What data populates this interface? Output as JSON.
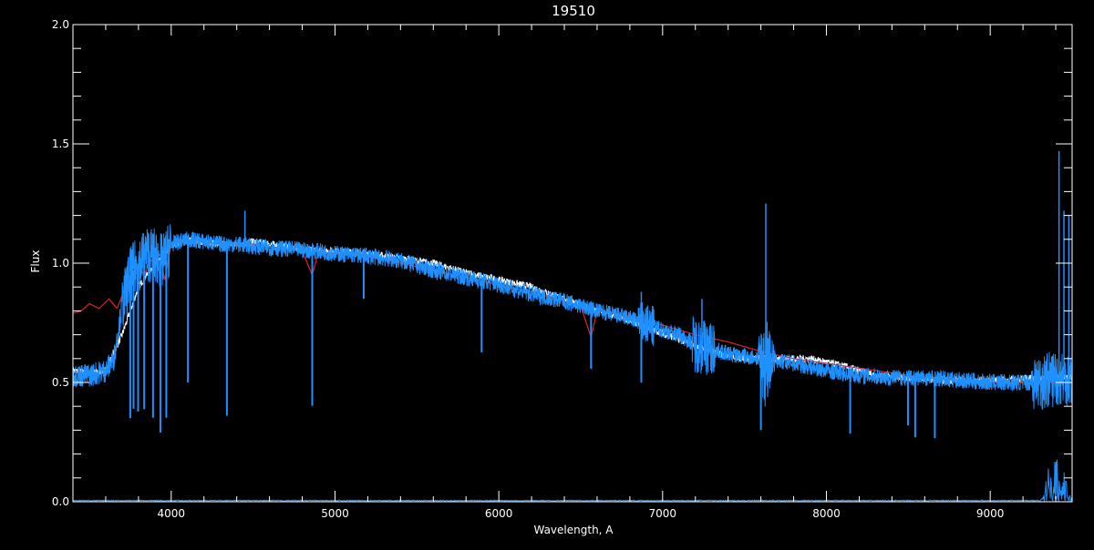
{
  "chart_data": {
    "type": "line",
    "title": "19510",
    "xlabel": "Wavelength, A",
    "ylabel": "Flux",
    "xlim": [
      3400,
      9500
    ],
    "ylim": [
      0.0,
      2.0
    ],
    "x_ticks": [
      4000,
      5000,
      6000,
      7000,
      8000,
      9000
    ],
    "x_tick_labels": [
      "4000",
      "5000",
      "6000",
      "7000",
      "8000",
      "9000"
    ],
    "y_ticks": [
      0.0,
      0.5,
      1.0,
      1.5,
      2.0
    ],
    "y_tick_labels": [
      "0.0",
      "0.5",
      "1.0",
      "1.5",
      "2.0"
    ],
    "x_minor_step": 200,
    "y_minor_step": 0.1,
    "grid": false,
    "background": "#000000",
    "axis_color": "#ffffff",
    "series": [
      {
        "color": "#ffffff",
        "style": "line",
        "x": [
          3400,
          3500,
          3600,
          3700,
          3800,
          3900,
          4000,
          4100,
          4200,
          4300,
          4400,
          4500,
          4700,
          4900,
          5000,
          5200,
          5400,
          5600,
          5800,
          6000,
          6200,
          6400,
          6600,
          6800,
          6950,
          7100,
          7300,
          7500,
          7700,
          7900,
          8100,
          8300,
          8500,
          8700,
          8900,
          9100,
          9300,
          9500
        ],
        "y": [
          0.55,
          0.54,
          0.55,
          0.7,
          0.9,
          1.0,
          1.07,
          1.1,
          1.09,
          1.08,
          1.08,
          1.09,
          1.07,
          1.05,
          1.05,
          1.04,
          1.02,
          1.0,
          0.96,
          0.93,
          0.9,
          0.85,
          0.8,
          0.76,
          0.72,
          0.68,
          0.63,
          0.6,
          0.6,
          0.6,
          0.57,
          0.53,
          0.52,
          0.51,
          0.51,
          0.51,
          0.52,
          0.52
        ]
      },
      {
        "color": "#e0202a",
        "style": "line",
        "x": [
          3400,
          3450,
          3500,
          3560,
          3620,
          3670,
          3720,
          3760,
          3800,
          3840,
          3870,
          3900,
          3930,
          3960,
          4000,
          4050,
          4100,
          4200,
          4300,
          4400,
          4500,
          4600,
          4700,
          4800,
          4861,
          4900,
          5000,
          5200,
          5400,
          5600,
          5800,
          6000,
          6200,
          6400,
          6500,
          6563,
          6600,
          6800,
          7000,
          7200,
          7400,
          7600,
          7800,
          8000,
          8200,
          8400,
          8600,
          8800,
          9000,
          9200,
          9400,
          9500
        ],
        "y": [
          0.79,
          0.8,
          0.83,
          0.81,
          0.85,
          0.81,
          0.9,
          0.92,
          0.98,
          0.95,
          1.02,
          0.99,
          1.04,
          0.93,
          1.08,
          1.09,
          1.1,
          1.09,
          1.08,
          1.08,
          1.08,
          1.07,
          1.06,
          1.05,
          0.95,
          1.05,
          1.04,
          1.03,
          1.0,
          0.97,
          0.94,
          0.91,
          0.88,
          0.84,
          0.82,
          0.69,
          0.8,
          0.78,
          0.74,
          0.7,
          0.67,
          0.63,
          0.6,
          0.58,
          0.56,
          0.54,
          0.52,
          0.51,
          0.5,
          0.5,
          0.5,
          0.5
        ]
      },
      {
        "color": "#1e90ff",
        "style": "noisy-spectrum",
        "x": [
          3400,
          3500,
          3600,
          3650,
          3700,
          3750,
          3800,
          3850,
          3900,
          3950,
          4000,
          4100,
          4200,
          4300,
          4400,
          4500,
          4700,
          4900,
          5000,
          5200,
          5400,
          5600,
          5800,
          6000,
          6200,
          6400,
          6600,
          6800,
          6900,
          7000,
          7100,
          7200,
          7300,
          7400,
          7500,
          7600,
          7700,
          7800,
          8000,
          8200,
          8400,
          8600,
          8800,
          9000,
          9200,
          9300,
          9400,
          9500
        ],
        "y": [
          0.53,
          0.53,
          0.55,
          0.6,
          0.82,
          0.95,
          1.0,
          1.04,
          1.03,
          1.0,
          1.08,
          1.1,
          1.09,
          1.08,
          1.08,
          1.07,
          1.06,
          1.05,
          1.04,
          1.03,
          1.01,
          0.97,
          0.94,
          0.91,
          0.87,
          0.84,
          0.8,
          0.77,
          0.74,
          0.72,
          0.7,
          0.66,
          0.64,
          0.62,
          0.61,
          0.6,
          0.59,
          0.58,
          0.55,
          0.53,
          0.52,
          0.52,
          0.51,
          0.5,
          0.5,
          0.5,
          0.52,
          0.52
        ]
      },
      {
        "color": "#1e90ff",
        "style": "error",
        "x": [
          3400,
          9300,
          9330,
          9350,
          9380,
          9400,
          9430,
          9450,
          9480,
          9500
        ],
        "y": [
          0.0,
          0.0,
          0.02,
          0.1,
          0.05,
          0.15,
          0.04,
          0.08,
          0.02,
          0.01
        ]
      }
    ],
    "absorption_lines": [
      {
        "x": 3750,
        "depth": 0.6
      },
      {
        "x": 3770,
        "depth": 0.58
      },
      {
        "x": 3798,
        "depth": 0.62
      },
      {
        "x": 3835,
        "depth": 0.64
      },
      {
        "x": 3889,
        "depth": 0.68
      },
      {
        "x": 3934,
        "depth": 0.72
      },
      {
        "x": 3970,
        "depth": 0.68
      },
      {
        "x": 4102,
        "depth": 0.6
      },
      {
        "x": 4340,
        "depth": 0.72
      },
      {
        "x": 4861,
        "depth": 0.65
      },
      {
        "x": 5175,
        "depth": 0.18
      },
      {
        "x": 5895,
        "depth": 0.3
      },
      {
        "x": 6563,
        "depth": 0.25
      },
      {
        "x": 6870,
        "depth": 0.25
      },
      {
        "x": 7600,
        "depth": 0.3
      },
      {
        "x": 8145,
        "depth": 0.25
      },
      {
        "x": 8498,
        "depth": 0.2
      },
      {
        "x": 8542,
        "depth": 0.25
      },
      {
        "x": 8662,
        "depth": 0.25
      }
    ],
    "emission_spikes": [
      {
        "x": 4450,
        "peak": 1.22
      },
      {
        "x": 6870,
        "peak": 0.88
      },
      {
        "x": 7240,
        "peak": 0.85
      },
      {
        "x": 7630,
        "peak": 1.25
      },
      {
        "x": 9420,
        "peak": 1.47
      },
      {
        "x": 9450,
        "peak": 1.22
      },
      {
        "x": 9480,
        "peak": 1.2
      }
    ]
  }
}
